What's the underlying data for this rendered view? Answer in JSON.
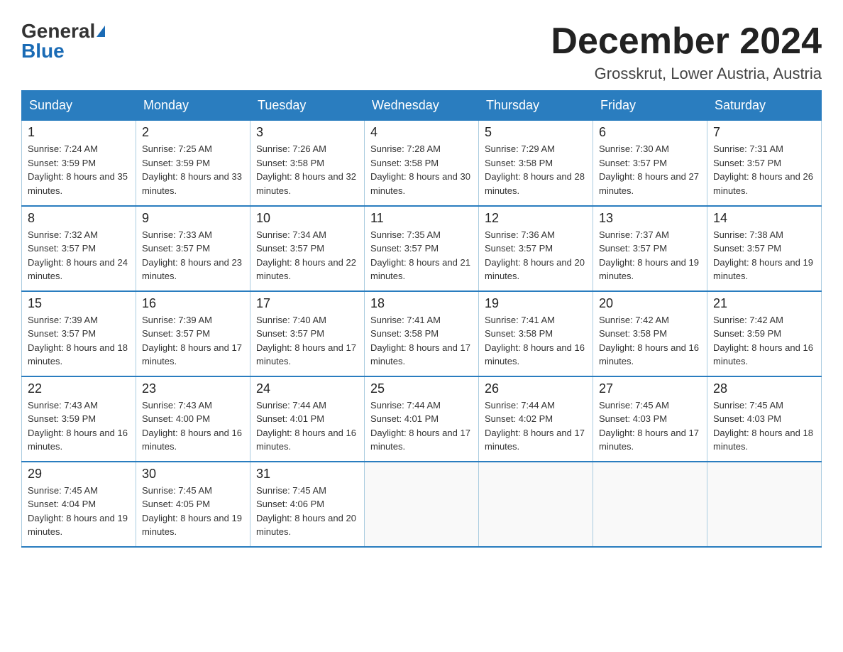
{
  "header": {
    "logo_general": "General",
    "logo_blue": "Blue",
    "title": "December 2024",
    "subtitle": "Grosskrut, Lower Austria, Austria"
  },
  "days_of_week": [
    "Sunday",
    "Monday",
    "Tuesday",
    "Wednesday",
    "Thursday",
    "Friday",
    "Saturday"
  ],
  "weeks": [
    [
      {
        "day": "1",
        "sunrise": "7:24 AM",
        "sunset": "3:59 PM",
        "daylight": "8 hours and 35 minutes."
      },
      {
        "day": "2",
        "sunrise": "7:25 AM",
        "sunset": "3:59 PM",
        "daylight": "8 hours and 33 minutes."
      },
      {
        "day": "3",
        "sunrise": "7:26 AM",
        "sunset": "3:58 PM",
        "daylight": "8 hours and 32 minutes."
      },
      {
        "day": "4",
        "sunrise": "7:28 AM",
        "sunset": "3:58 PM",
        "daylight": "8 hours and 30 minutes."
      },
      {
        "day": "5",
        "sunrise": "7:29 AM",
        "sunset": "3:58 PM",
        "daylight": "8 hours and 28 minutes."
      },
      {
        "day": "6",
        "sunrise": "7:30 AM",
        "sunset": "3:57 PM",
        "daylight": "8 hours and 27 minutes."
      },
      {
        "day": "7",
        "sunrise": "7:31 AM",
        "sunset": "3:57 PM",
        "daylight": "8 hours and 26 minutes."
      }
    ],
    [
      {
        "day": "8",
        "sunrise": "7:32 AM",
        "sunset": "3:57 PM",
        "daylight": "8 hours and 24 minutes."
      },
      {
        "day": "9",
        "sunrise": "7:33 AM",
        "sunset": "3:57 PM",
        "daylight": "8 hours and 23 minutes."
      },
      {
        "day": "10",
        "sunrise": "7:34 AM",
        "sunset": "3:57 PM",
        "daylight": "8 hours and 22 minutes."
      },
      {
        "day": "11",
        "sunrise": "7:35 AM",
        "sunset": "3:57 PM",
        "daylight": "8 hours and 21 minutes."
      },
      {
        "day": "12",
        "sunrise": "7:36 AM",
        "sunset": "3:57 PM",
        "daylight": "8 hours and 20 minutes."
      },
      {
        "day": "13",
        "sunrise": "7:37 AM",
        "sunset": "3:57 PM",
        "daylight": "8 hours and 19 minutes."
      },
      {
        "day": "14",
        "sunrise": "7:38 AM",
        "sunset": "3:57 PM",
        "daylight": "8 hours and 19 minutes."
      }
    ],
    [
      {
        "day": "15",
        "sunrise": "7:39 AM",
        "sunset": "3:57 PM",
        "daylight": "8 hours and 18 minutes."
      },
      {
        "day": "16",
        "sunrise": "7:39 AM",
        "sunset": "3:57 PM",
        "daylight": "8 hours and 17 minutes."
      },
      {
        "day": "17",
        "sunrise": "7:40 AM",
        "sunset": "3:57 PM",
        "daylight": "8 hours and 17 minutes."
      },
      {
        "day": "18",
        "sunrise": "7:41 AM",
        "sunset": "3:58 PM",
        "daylight": "8 hours and 17 minutes."
      },
      {
        "day": "19",
        "sunrise": "7:41 AM",
        "sunset": "3:58 PM",
        "daylight": "8 hours and 16 minutes."
      },
      {
        "day": "20",
        "sunrise": "7:42 AM",
        "sunset": "3:58 PM",
        "daylight": "8 hours and 16 minutes."
      },
      {
        "day": "21",
        "sunrise": "7:42 AM",
        "sunset": "3:59 PM",
        "daylight": "8 hours and 16 minutes."
      }
    ],
    [
      {
        "day": "22",
        "sunrise": "7:43 AM",
        "sunset": "3:59 PM",
        "daylight": "8 hours and 16 minutes."
      },
      {
        "day": "23",
        "sunrise": "7:43 AM",
        "sunset": "4:00 PM",
        "daylight": "8 hours and 16 minutes."
      },
      {
        "day": "24",
        "sunrise": "7:44 AM",
        "sunset": "4:01 PM",
        "daylight": "8 hours and 16 minutes."
      },
      {
        "day": "25",
        "sunrise": "7:44 AM",
        "sunset": "4:01 PM",
        "daylight": "8 hours and 17 minutes."
      },
      {
        "day": "26",
        "sunrise": "7:44 AM",
        "sunset": "4:02 PM",
        "daylight": "8 hours and 17 minutes."
      },
      {
        "day": "27",
        "sunrise": "7:45 AM",
        "sunset": "4:03 PM",
        "daylight": "8 hours and 17 minutes."
      },
      {
        "day": "28",
        "sunrise": "7:45 AM",
        "sunset": "4:03 PM",
        "daylight": "8 hours and 18 minutes."
      }
    ],
    [
      {
        "day": "29",
        "sunrise": "7:45 AM",
        "sunset": "4:04 PM",
        "daylight": "8 hours and 19 minutes."
      },
      {
        "day": "30",
        "sunrise": "7:45 AM",
        "sunset": "4:05 PM",
        "daylight": "8 hours and 19 minutes."
      },
      {
        "day": "31",
        "sunrise": "7:45 AM",
        "sunset": "4:06 PM",
        "daylight": "8 hours and 20 minutes."
      },
      null,
      null,
      null,
      null
    ]
  ]
}
